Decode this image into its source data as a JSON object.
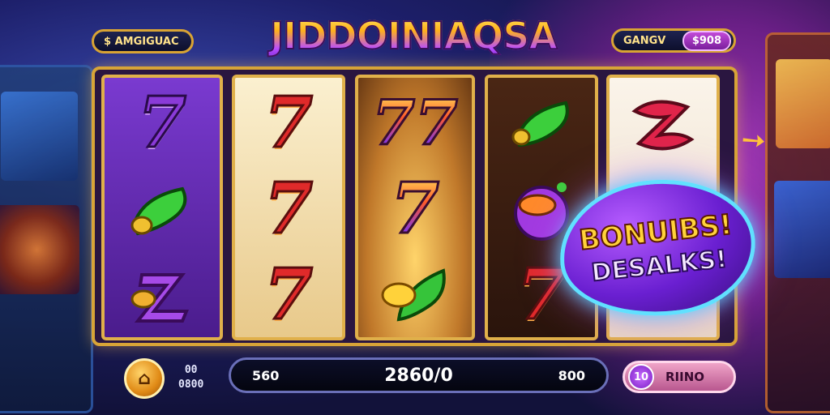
{
  "logo": {
    "text": "JIDDOINIAQSA"
  },
  "left_pill": {
    "icon": "coin-icon",
    "text": "$ AMGIGUAC"
  },
  "right_pill": {
    "label": "GANGV",
    "value": "$908"
  },
  "reels": [
    {
      "colors": {
        "bg": "#6a2fb8"
      },
      "symbols": [
        "7",
        "green-horn",
        "purple-swirl"
      ]
    },
    {
      "colors": {
        "bg": "#f5e6c0"
      },
      "symbols": [
        "7",
        "7",
        "7"
      ]
    },
    {
      "colors": {
        "bg": "#c98a2e"
      },
      "symbols": [
        "77",
        "7",
        "gold-green-horn"
      ]
    },
    {
      "colors": {
        "bg": "#3a1b12"
      },
      "symbols": [
        "green-horn",
        "purple-gem",
        "7"
      ]
    },
    {
      "colors": {
        "bg": "#f6efe4"
      },
      "symbols": [
        "red-swirl",
        "",
        ""
      ]
    }
  ],
  "bonus": {
    "line1": "BONUIBS!",
    "line2": "DESALKS!"
  },
  "controls": {
    "coin_button_icon": "home-icon",
    "mini_line1": "00",
    "mini_line2": "0800",
    "bar_left": "560",
    "bar_center": "2860/0",
    "bar_right": "800",
    "bet_value": "10",
    "spin_label": "RIINO"
  }
}
